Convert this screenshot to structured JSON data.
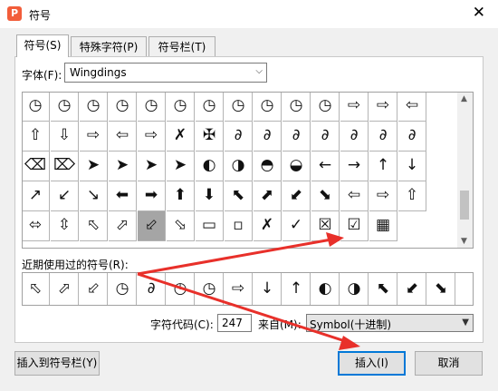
{
  "window": {
    "title": "符号",
    "app_icon_letter": "P",
    "close_glyph": "✕"
  },
  "tabs": [
    {
      "label": "符号(S)",
      "active": true
    },
    {
      "label": "特殊字符(P)",
      "active": false
    },
    {
      "label": "符号栏(T)",
      "active": false
    }
  ],
  "font": {
    "label": "字体(F):",
    "value": "Wingdings"
  },
  "symbol_grid": {
    "rows": [
      [
        "◷",
        "◷",
        "◷",
        "◷",
        "◷",
        "◷",
        "◷",
        "◷",
        "◷",
        "◷",
        "◷",
        "⇨",
        "⇨",
        "⇦"
      ],
      [
        "⇧",
        "⇩",
        "⇨",
        "⇦",
        "⇨",
        "✗",
        "✠",
        "∂",
        "∂",
        "∂",
        "∂",
        "∂",
        "∂",
        "∂"
      ],
      [
        "⌫",
        "⌦",
        "➤",
        "➤",
        "➤",
        "➤",
        "◐",
        "◑",
        "◓",
        "◒",
        "←",
        "→",
        "↑",
        "↓"
      ],
      [
        "↗",
        "↙",
        "↘",
        "⬅",
        "➡",
        "⬆",
        "⬇",
        "⬉",
        "⬈",
        "⬋",
        "⬊",
        "⇦",
        "⇨",
        "⇧"
      ],
      [
        "⬄",
        "⇳",
        "⬁",
        "⬀",
        "⬃",
        "⬂",
        "▭",
        "▫",
        "✗",
        "✓",
        "☒",
        "☑",
        "▦"
      ]
    ],
    "last_row_full": [
      "⇩"
    ],
    "selected_row": 4,
    "selected_col": 4
  },
  "recent": {
    "label": "近期使用过的符号(R):",
    "symbols": [
      "⬁",
      "⬀",
      "⬃",
      "◷",
      "∂",
      "◷",
      "◷",
      "⇨",
      "↓",
      "↑",
      "◐",
      "◑",
      "⬉",
      "⬋",
      "⬊"
    ]
  },
  "char_code": {
    "label": "字符代码(C):",
    "value": "247"
  },
  "from": {
    "label": "来自(M):",
    "value": "Symbol(十进制)"
  },
  "buttons": {
    "insert_to_bar": "插入到符号栏(Y)",
    "insert": "插入(I)",
    "cancel": "取消"
  },
  "colors": {
    "accent": "#0078d7",
    "annotation": "#e8302a",
    "app_icon": "#f25d3a"
  }
}
